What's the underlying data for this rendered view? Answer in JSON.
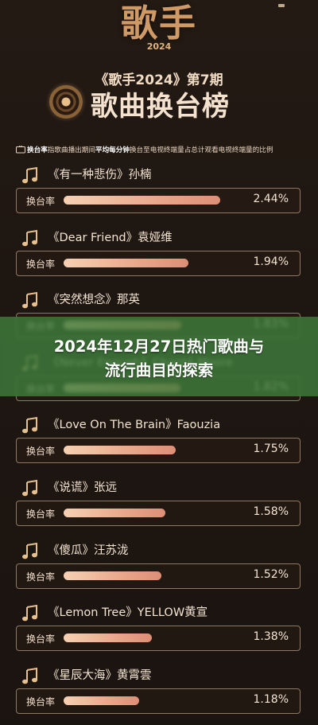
{
  "header": {
    "logo_text": "歌手",
    "logo_year": "2024",
    "subtitle": "《歌手2024》第7期",
    "headline": "歌曲换台榜",
    "note_prefix": "换台率",
    "note_text_1": "指歌曲播出期间",
    "note_bold": "平均每分钟",
    "note_text_2": "换台至电视终端量占总计观看电视终端量的比例"
  },
  "banner": {
    "line1": "2024年12月27日热门歌曲与",
    "line2": "流行曲目的探索"
  },
  "colors": {
    "background": "#1b1410",
    "bar_fill": "#e9a78a",
    "banner": "#407c3c"
  },
  "chart_data": {
    "type": "bar",
    "title": "歌曲换台榜",
    "metric_label": "换台率",
    "unit": "%",
    "categories": [
      "《有一种悲伤》孙楠",
      "《Dear Friend》袁娅维",
      "《突然想念》那英",
      "《Never Enough》Chanté Moore",
      "《Love On The Brain》Faouzia",
      "《说谎》张远",
      "《傻瓜》汪苏泷",
      "《Lemon Tree》YELLOW黄宣",
      "《星辰大海》黄霄雲"
    ],
    "values": [
      2.44,
      1.94,
      1.83,
      1.82,
      1.75,
      1.58,
      1.52,
      1.38,
      1.18
    ],
    "value_labels": [
      "2.44%",
      "1.94%",
      "1.83%",
      "1.82%",
      "1.75%",
      "1.58%",
      "1.52%",
      "1.38%",
      "1.18%"
    ],
    "xlim": [
      0,
      2.44
    ]
  }
}
